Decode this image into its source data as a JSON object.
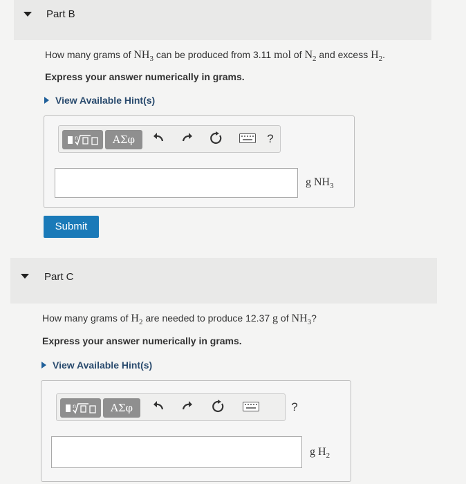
{
  "partB": {
    "title": "Part B",
    "question": {
      "pre": "How many grams of ",
      "sp1": "NH",
      "sub1": "3",
      "mid1": " can be produced from ",
      "amount": "3.11",
      "amount_unit": "mol",
      "mid2": " of ",
      "sp2": "N",
      "sub2": "2",
      "mid3": " and excess ",
      "sp3": "H",
      "sub3": "2",
      "post": "."
    },
    "instruction": "Express your answer numerically in grams.",
    "hint": "View Available Hint(s)",
    "unit": {
      "pre": "g NH",
      "sub": "3"
    },
    "submit": "Submit"
  },
  "partC": {
    "title": "Part C",
    "question": {
      "pre": "How many grams of ",
      "sp1": "H",
      "sub1": "2",
      "mid1": " are needed to produce ",
      "amount": "12.37",
      "amount_unit": "g",
      "mid2": " of ",
      "sp2": "NH",
      "sub2": "3",
      "post": "?"
    },
    "instruction": "Express your answer numerically in grams.",
    "hint": "View Available Hint(s)",
    "unit": {
      "pre": "g H",
      "sub": "2"
    }
  },
  "toolbar": {
    "greek_label": "ΑΣφ",
    "help_label": "?"
  },
  "icons": {
    "collapse": "caret-down-icon",
    "hint": "triangle-right-icon",
    "templates": "math-templates-icon",
    "undo": "undo-icon",
    "redo": "redo-icon",
    "reset": "reset-icon",
    "keyboard": "keyboard-icon"
  }
}
